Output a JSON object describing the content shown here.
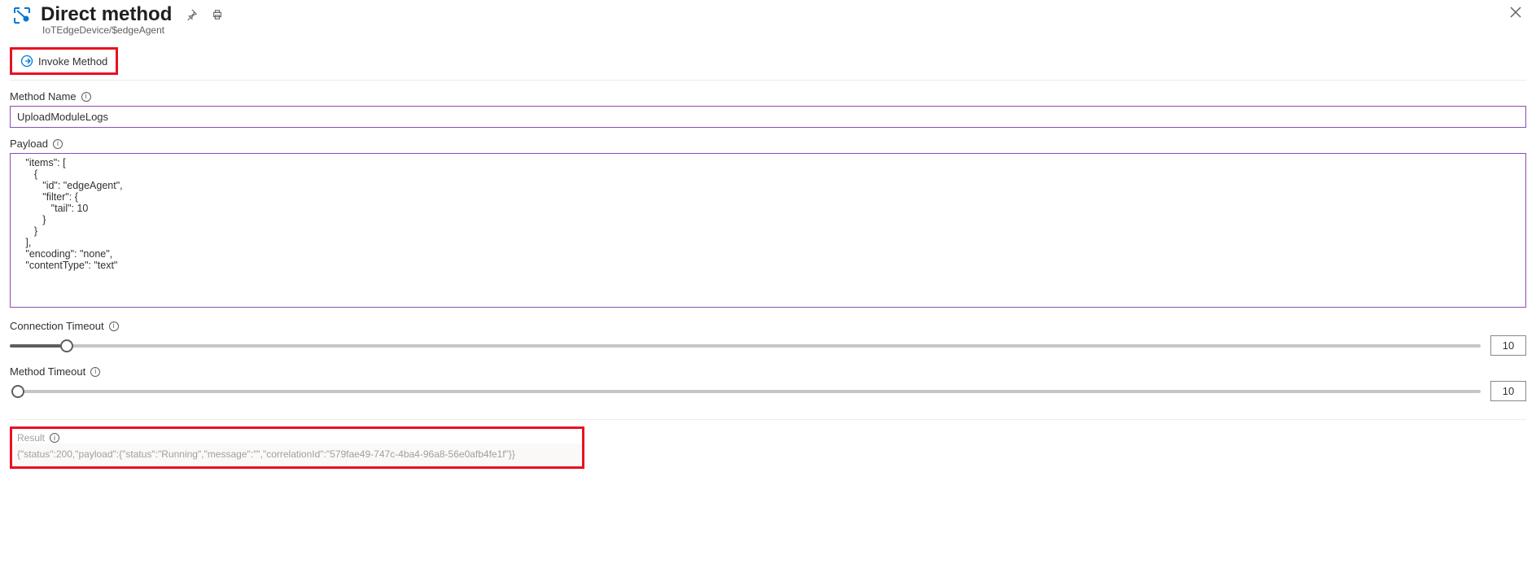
{
  "header": {
    "title": "Direct method",
    "breadcrumb": "IoTEdgeDevice/$edgeAgent"
  },
  "toolbar": {
    "invoke_label": "Invoke Method"
  },
  "form": {
    "method_name_label": "Method Name",
    "method_name_value": "UploadModuleLogs",
    "payload_label": "Payload",
    "payload_value": "   \"items\": [\n      {\n         \"id\": \"edgeAgent\",\n         \"filter\": {\n            \"tail\": 10\n         }\n      }\n   ],\n   \"encoding\": \"none\",\n   \"contentType\": \"text\"",
    "connection_timeout_label": "Connection Timeout",
    "connection_timeout_value": "10",
    "method_timeout_label": "Method Timeout",
    "method_timeout_value": "10"
  },
  "result": {
    "label": "Result",
    "value": "{\"status\":200,\"payload\":{\"status\":\"Running\",\"message\":\"\",\"correlationId\":\"579fae49-747c-4ba4-96a8-56e0afb4fe1f\"}}"
  }
}
